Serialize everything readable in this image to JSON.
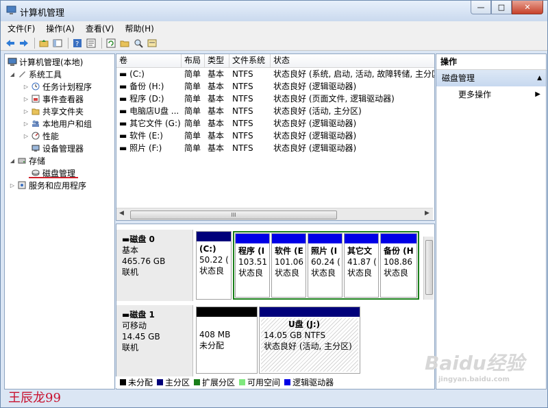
{
  "window": {
    "title": "计算机管理",
    "buttons": {
      "minimize": "—",
      "maximize": "□",
      "close": "✕"
    }
  },
  "menu": [
    "文件(F)",
    "操作(A)",
    "查看(V)",
    "帮助(H)"
  ],
  "tree": {
    "root": "计算机管理(本地)",
    "system_tools": "系统工具",
    "task_scheduler": "任务计划程序",
    "event_viewer": "事件查看器",
    "shared_folders": "共享文件夹",
    "local_users": "本地用户和组",
    "performance": "性能",
    "device_manager": "设备管理器",
    "storage": "存储",
    "disk_management": "磁盘管理",
    "services_apps": "服务和应用程序"
  },
  "volume_list": {
    "headers": [
      "卷",
      "布局",
      "类型",
      "文件系统",
      "状态"
    ],
    "rows": [
      [
        "(C:)",
        "简单",
        "基本",
        "NTFS",
        "状态良好 (系统, 启动, 活动, 故障转储, 主分区)"
      ],
      [
        "备份 (H:)",
        "简单",
        "基本",
        "NTFS",
        "状态良好 (逻辑驱动器)"
      ],
      [
        "程序 (D:)",
        "简单",
        "基本",
        "NTFS",
        "状态良好 (页面文件, 逻辑驱动器)"
      ],
      [
        "电脑店U盘 ...",
        "简单",
        "基本",
        "NTFS",
        "状态良好 (活动, 主分区)"
      ],
      [
        "其它文件 (G:)",
        "简单",
        "基本",
        "NTFS",
        "状态良好 (逻辑驱动器)"
      ],
      [
        "软件 (E:)",
        "简单",
        "基本",
        "NTFS",
        "状态良好 (逻辑驱动器)"
      ],
      [
        "照片 (F:)",
        "简单",
        "基本",
        "NTFS",
        "状态良好 (逻辑驱动器)"
      ]
    ],
    "scroll_grip": "III"
  },
  "disks": [
    {
      "name": "磁盘 0",
      "type": "基本",
      "size": "465.76 GB",
      "status": "联机",
      "partitions": [
        {
          "name": "(C:)",
          "size": "50.22 (",
          "status": "状态良"
        },
        {
          "name": "程序 (I",
          "size": "103.51",
          "status": "状态良"
        },
        {
          "name": "软件 (E",
          "size": "101.06",
          "status": "状态良"
        },
        {
          "name": "照片 (I",
          "size": "60.24 (",
          "status": "状态良"
        },
        {
          "name": "其它文",
          "size": "41.87 (",
          "status": "状态良"
        },
        {
          "name": "备份 (H",
          "size": "108.86",
          "status": "状态良"
        }
      ]
    },
    {
      "name": "磁盘 1",
      "type": "可移动",
      "size": "14.45 GB",
      "status": "联机",
      "partitions": [
        {
          "name": "",
          "size": "408 MB",
          "status": "未分配"
        },
        {
          "name": "U盘  (J:)",
          "size": "14.05 GB NTFS",
          "status": "状态良好 (活动, 主分区)"
        }
      ]
    }
  ],
  "legend": [
    {
      "label": "未分配",
      "color": "#000000"
    },
    {
      "label": "主分区",
      "color": "#00007a"
    },
    {
      "label": "扩展分区",
      "color": "#1a7f1a"
    },
    {
      "label": "可用空间",
      "color": "#7fe87f"
    },
    {
      "label": "逻辑驱动器",
      "color": "#0000e6"
    }
  ],
  "actions": {
    "header": "操作",
    "section": "磁盘管理",
    "more": "更多操作"
  },
  "signature": "王辰龙99",
  "watermark": {
    "main": "Baidu经验",
    "sub": "jingyan.baidu.com"
  },
  "colors": {
    "primary_partition": "#00007a",
    "logical_drive": "#0000e6",
    "extended_partition": "#1a7f1a",
    "unallocated": "#000000"
  }
}
